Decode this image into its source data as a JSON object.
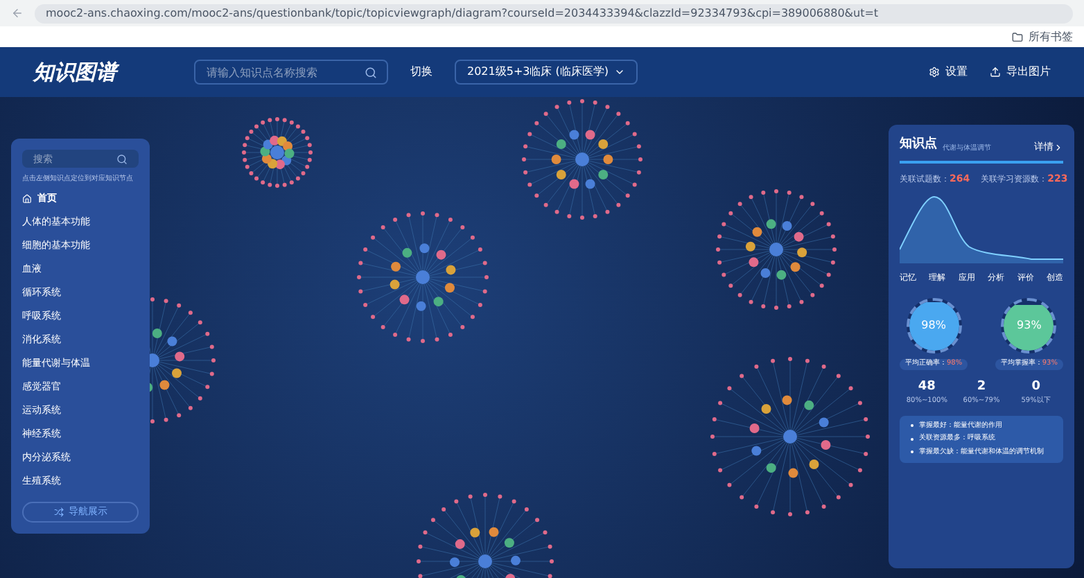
{
  "browser": {
    "url": "mooc2-ans.chaoxing.com/mooc2-ans/questionbank/topic/topicviewgraph/diagram?courseId=2034433394&clazzId=92334793&cpi=389006880&ut=t",
    "bookmark": "所有书签"
  },
  "header": {
    "logo": "知识图谱",
    "search_placeholder": "请输入知识点名称搜索",
    "switch_label": "切换",
    "class_select": "2021级5+3临床 (临床医学)",
    "actions": [
      "设置",
      "导出图片"
    ]
  },
  "sidebar": {
    "search_placeholder": "搜索",
    "hint": "点击左侧知识点定位到对应知识节点",
    "items": [
      {
        "label": "首页",
        "kind": "home"
      },
      {
        "label": "人体的基本功能",
        "kind": "item"
      },
      {
        "label": "细胞的基本功能",
        "kind": "item"
      },
      {
        "label": "血液",
        "kind": "item"
      },
      {
        "label": "循环系统",
        "kind": "item"
      },
      {
        "label": "呼吸系统",
        "kind": "item"
      },
      {
        "label": "消化系统",
        "kind": "item"
      },
      {
        "label": "能量代谢与体温",
        "kind": "item"
      },
      {
        "label": "感觉器官",
        "kind": "item"
      },
      {
        "label": "运动系统",
        "kind": "item"
      },
      {
        "label": "神经系统",
        "kind": "item"
      },
      {
        "label": "内分泌系统",
        "kind": "item"
      },
      {
        "label": "生殖系统",
        "kind": "item"
      }
    ],
    "button": "导航展示"
  },
  "panel": {
    "title": "知识点",
    "subtitle": "代谢与体温调节",
    "detail_link": "详情",
    "stats": [
      {
        "label": "关联试题数：",
        "value": "264"
      },
      {
        "label": "关联学习资源数：",
        "value": "223"
      }
    ],
    "chart_labels": [
      "记忆",
      "理解",
      "应用",
      "分析",
      "评价",
      "创造"
    ],
    "gauges": [
      {
        "value": "98%",
        "label": "平均正确率：",
        "reading": "98%",
        "level": 0.98,
        "color": "#4aa8f0"
      },
      {
        "value": "93%",
        "label": "平均掌握率：",
        "reading": "93%",
        "level": 0.93,
        "color": "#5cc79a"
      }
    ],
    "counts": [
      {
        "value": "48",
        "range": "80%~100%"
      },
      {
        "value": "2",
        "range": "60%~79%"
      },
      {
        "value": "0",
        "range": "59%以下"
      }
    ],
    "notes": [
      "掌握最好：能量代谢的作用",
      "关联资源最多：呼吸系统",
      "掌握最欠缺：能量代谢和体温的调节机制"
    ]
  }
}
